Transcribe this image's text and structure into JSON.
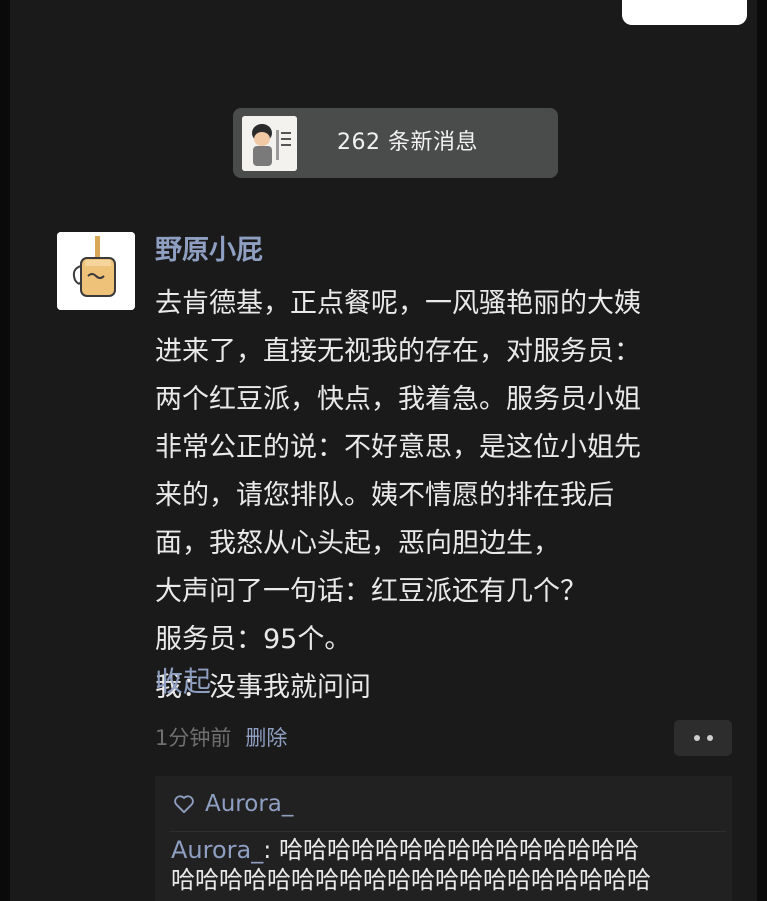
{
  "banner": {
    "new_messages_label": "262 条新消息",
    "avatar_icon": "cartoon-boy-avatar-icon"
  },
  "post": {
    "avatar_icon": "honey-jar-avatar-icon",
    "nickname": "野原小屁",
    "content_lines": [
      "去肯德基，正点餐呢，一风骚艳丽的大姨",
      "进来了，直接无视我的存在，对服务员：",
      "两个红豆派，快点，我着急。服务员小姐",
      "非常公正的说：不好意思，是这位小姐先",
      "来的，请您排队。姨不情愿的排在我后",
      "面，我怒从心头起，恶向胆边生，",
      "大声问了一句话：红豆派还有几个？",
      "服务员：95个。",
      "我：没事我就问问"
    ],
    "collapse_label": "收起",
    "time_ago": "1分钟前",
    "delete_label": "删除",
    "more_icon": "more-dots-icon"
  },
  "interactions": {
    "like_icon": "heart-outline-icon",
    "likes": "Aurora_",
    "comment": {
      "author": "Aurora_",
      "separator": ": ",
      "line1_text": "哈哈哈哈哈哈哈哈哈哈哈哈哈哈哈",
      "line2_text": "哈哈哈哈哈哈哈哈哈哈哈哈哈哈哈哈哈哈哈哈"
    }
  },
  "colors": {
    "background": "#1a1a1a",
    "link_blue": "#8f9fc2",
    "text_primary": "#e9e9e9",
    "text_secondary": "#6f6f6f",
    "pill_bg": "#4a4b4b",
    "comment_bg": "#212121"
  }
}
